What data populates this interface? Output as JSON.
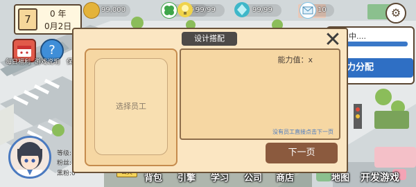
{
  "date": {
    "day": "7",
    "year_label": "0 年",
    "month_day": "0月2日"
  },
  "resources": [
    {
      "icon": "coins-icon",
      "value": "99,000",
      "color": "#e4b33a"
    },
    {
      "icon": "clover-icon",
      "value": "99/99",
      "color": "#3fa54a"
    },
    {
      "icon": "lightbulb-icon",
      "value": "99/99",
      "color": "#f0d34a"
    },
    {
      "icon": "crystal-icon",
      "value": "99/99",
      "color": "#3fb7c9"
    },
    {
      "icon": "mail-icon",
      "value": "10",
      "color": "#7cc3e6"
    }
  ],
  "side": {
    "daily_welfare": "每日福利",
    "game_guide": "游戏说明",
    "cut_label": "保"
  },
  "right_panel": {
    "developing": "发中....",
    "allocate": "力分配"
  },
  "modal": {
    "title": "设计搭配",
    "select_staff": "选择员工",
    "ability_label": "能力值：x",
    "hint": "没有员工直接点击下一页",
    "next_button": "下一页"
  },
  "player": {
    "level": "等级:",
    "fans": "粉丝:",
    "black_fans": "黑粉:0"
  },
  "nav": {
    "public": "公关",
    "bag": "背包",
    "engine": "引擎",
    "study": "学习",
    "company": "公司",
    "shop": "商店",
    "map": "地图",
    "develop": "开发游戏"
  },
  "colors": {
    "modal_bg": "#fbe6c2",
    "accent_brown": "#8b5a3e",
    "title_bg": "#4d4a48",
    "hint_blue": "#4a7ac0"
  }
}
